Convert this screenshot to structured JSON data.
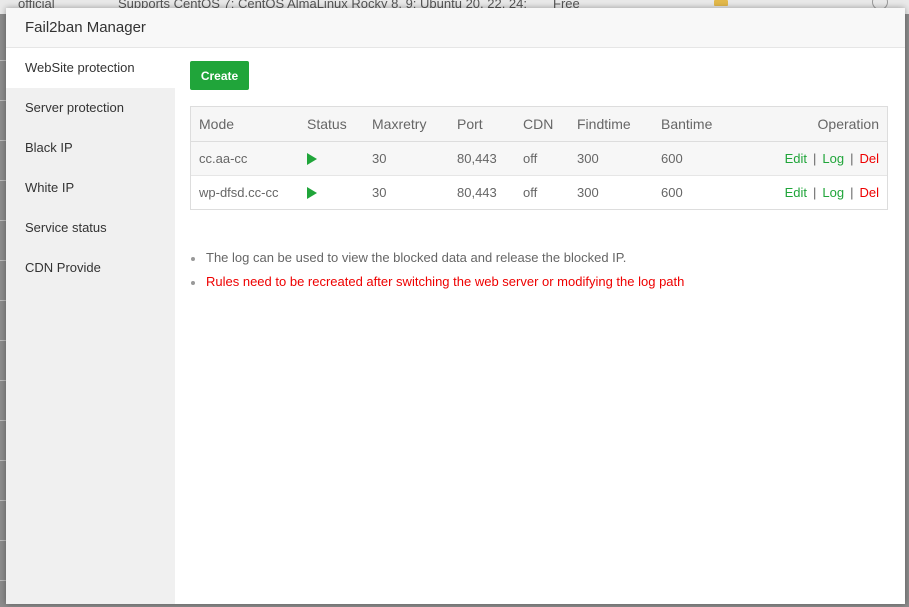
{
  "background": {
    "col1": "official",
    "col2": "Supports CentOS 7; CentOS AlmaLinux Rocky  8, 9; Ubuntu  20, 22, 24;",
    "col3": "Free"
  },
  "dialog": {
    "title": "Fail2ban Manager"
  },
  "sidebar": {
    "items": [
      {
        "label": "WebSite protection",
        "active": true
      },
      {
        "label": "Server protection"
      },
      {
        "label": "Black IP"
      },
      {
        "label": "White IP"
      },
      {
        "label": "Service status"
      },
      {
        "label": "CDN Provide"
      }
    ]
  },
  "toolbar": {
    "create_label": "Create"
  },
  "table": {
    "headers": [
      "Mode",
      "Status",
      "Maxretry",
      "Port",
      "CDN",
      "Findtime",
      "Bantime",
      "Operation"
    ],
    "rows": [
      {
        "mode": "cc.aa-cc",
        "status": "running",
        "maxretry": "30",
        "port": "80,443",
        "cdn": "off",
        "findtime": "300",
        "bantime": "600"
      },
      {
        "mode": "wp-dfsd.cc-cc",
        "status": "running",
        "maxretry": "30",
        "port": "80,443",
        "cdn": "off",
        "findtime": "300",
        "bantime": "600"
      }
    ],
    "ops": {
      "edit": "Edit",
      "log": "Log",
      "del": "Del",
      "sep": "|"
    }
  },
  "notes": [
    "The log can be used to view the blocked data and release the blocked IP.",
    "Rules need to be recreated after switching the web server or modifying the log path"
  ],
  "colors": {
    "accent": "#20a53a",
    "danger": "#ee0000",
    "sidebar_bg": "#f0f0f0"
  },
  "icons": {
    "status_running": "play-icon"
  }
}
